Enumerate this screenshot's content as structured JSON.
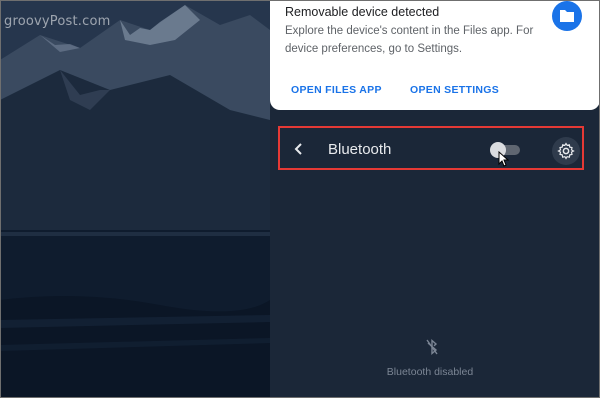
{
  "watermark": "groovyPost.com",
  "notification": {
    "title": "Removable device detected",
    "body": "Explore the device's content in the Files app. For device preferences, go to Settings.",
    "icon": "folder-icon",
    "buttons": {
      "open_files": "OPEN FILES APP",
      "open_settings": "OPEN SETTINGS"
    }
  },
  "bluetooth": {
    "title": "Bluetooth",
    "toggle_on": false,
    "status": "Bluetooth disabled"
  },
  "colors": {
    "accent": "#1a73e8",
    "highlight": "#e53935",
    "panel": "#1b2738"
  }
}
